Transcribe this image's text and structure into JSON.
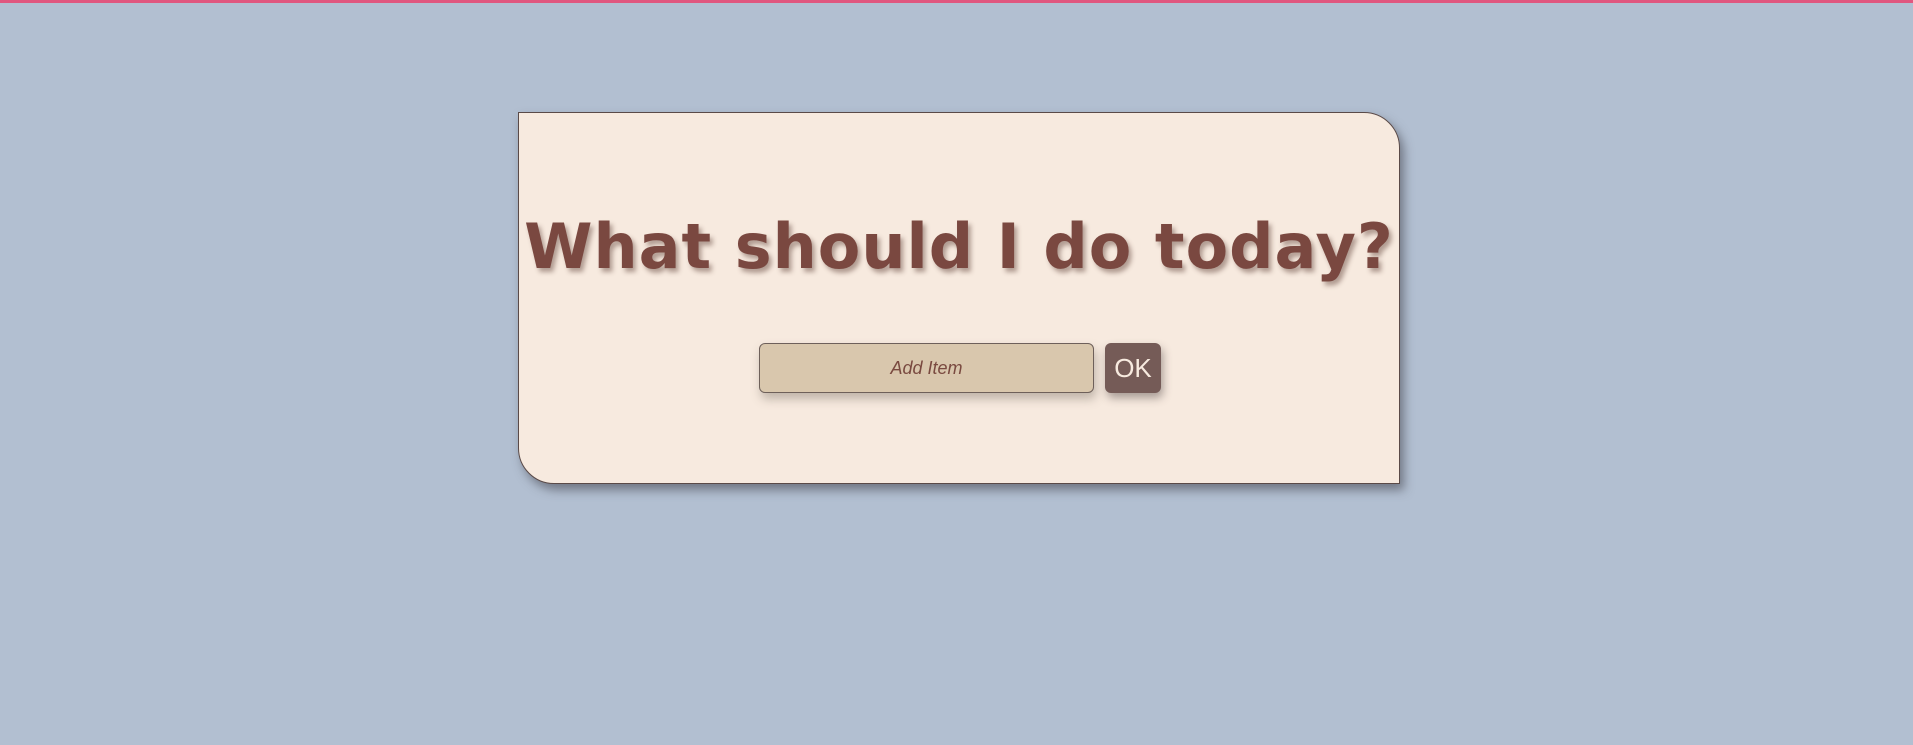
{
  "page": {
    "background_color": "#b2bfd1",
    "accent_color": "#e0577f"
  },
  "card": {
    "title": "What should I do today?",
    "background_color": "#f7eadf",
    "title_color": "#7a4840"
  },
  "add_form": {
    "input_value": "",
    "input_placeholder": "Add Item",
    "submit_label": "OK",
    "button_color": "#755b57"
  }
}
